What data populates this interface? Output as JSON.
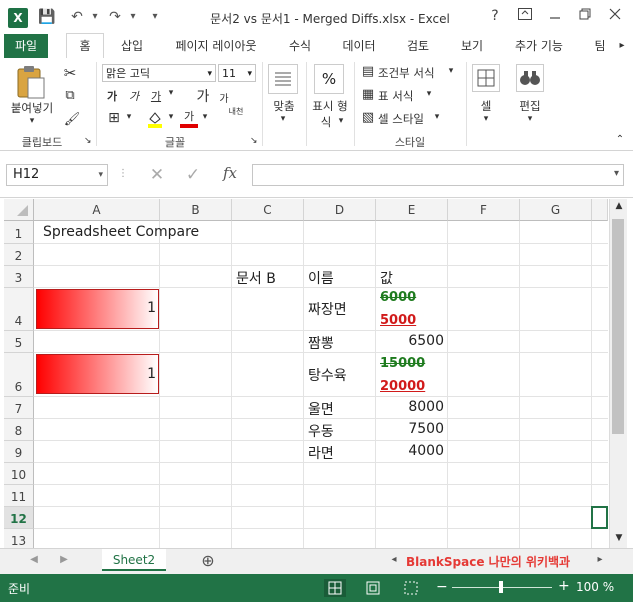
{
  "window": {
    "title": "문서2 vs 문서1 - Merged Diffs.xlsx - Excel",
    "help": "?",
    "logo": "X"
  },
  "qat": {
    "save": "💾",
    "undo": "↶",
    "redo": "↷",
    "customize": "▾"
  },
  "tabs": [
    "파일",
    "홈",
    "삽입",
    "페이지 레이아웃",
    "수식",
    "데이터",
    "검토",
    "보기",
    "추가 기능",
    "팀"
  ],
  "ribbon": {
    "clipboard": {
      "paste": "붙여넣기",
      "group": "클립보드"
    },
    "font": {
      "name": "맑은 고딕",
      "size": "11",
      "bold": "가",
      "italic": "가",
      "underline": "가",
      "grow": "가",
      "shrink": "가",
      "phonetic": "내천",
      "group": "글꼴"
    },
    "alignment": {
      "label": "맞춤"
    },
    "number": {
      "label1": "표시 형",
      "label2": "식",
      "symbol": "%"
    },
    "styles": {
      "conditional": "조건부 서식",
      "table": "표 서식",
      "cell": "셀 스타일",
      "group": "스타일"
    },
    "cells": {
      "label": "셀"
    },
    "editing": {
      "label": "편집"
    }
  },
  "formula_bar": {
    "name_box": "H12",
    "cancel": "✕",
    "enter": "✓",
    "fx": "fx",
    "value": ""
  },
  "columns": [
    "A",
    "B",
    "C",
    "D",
    "E",
    "F",
    "G"
  ],
  "rows": [
    "1",
    "2",
    "3",
    "4",
    "5",
    "6",
    "7",
    "8",
    "9",
    "10",
    "11",
    "12",
    "13"
  ],
  "cells": {
    "a1": "Spreadsheet Compare",
    "c3": "문서 B",
    "d3": "이름",
    "e3": "값",
    "a4": "1",
    "d4": "짜장면",
    "e4_old": "6000",
    "e4_new": "5000",
    "d5": "짬뽕",
    "e5": "6500",
    "a6": "1",
    "d6": "탕수육",
    "e6_old": "15000",
    "e6_new": "20000",
    "d7": "울면",
    "e7": "8000",
    "d8": "우동",
    "e8": "7500",
    "d9": "라면",
    "e9": "4000"
  },
  "data_bars": {
    "a4": 1.0,
    "a6": 1.0
  },
  "selected_cell": "H12",
  "sheet": {
    "name": "Sheet2",
    "add": "⊕",
    "watermark": "BlankSpace 나만의 위키백과"
  },
  "status": {
    "ready": "준비",
    "zoom": "100 %",
    "zoom_out": "−",
    "zoom_in": "+"
  },
  "colors": {
    "excel_green": "#217346",
    "old_value": "#1e7b1e",
    "new_value": "#d11a1a",
    "data_bar": "#ff0000"
  }
}
